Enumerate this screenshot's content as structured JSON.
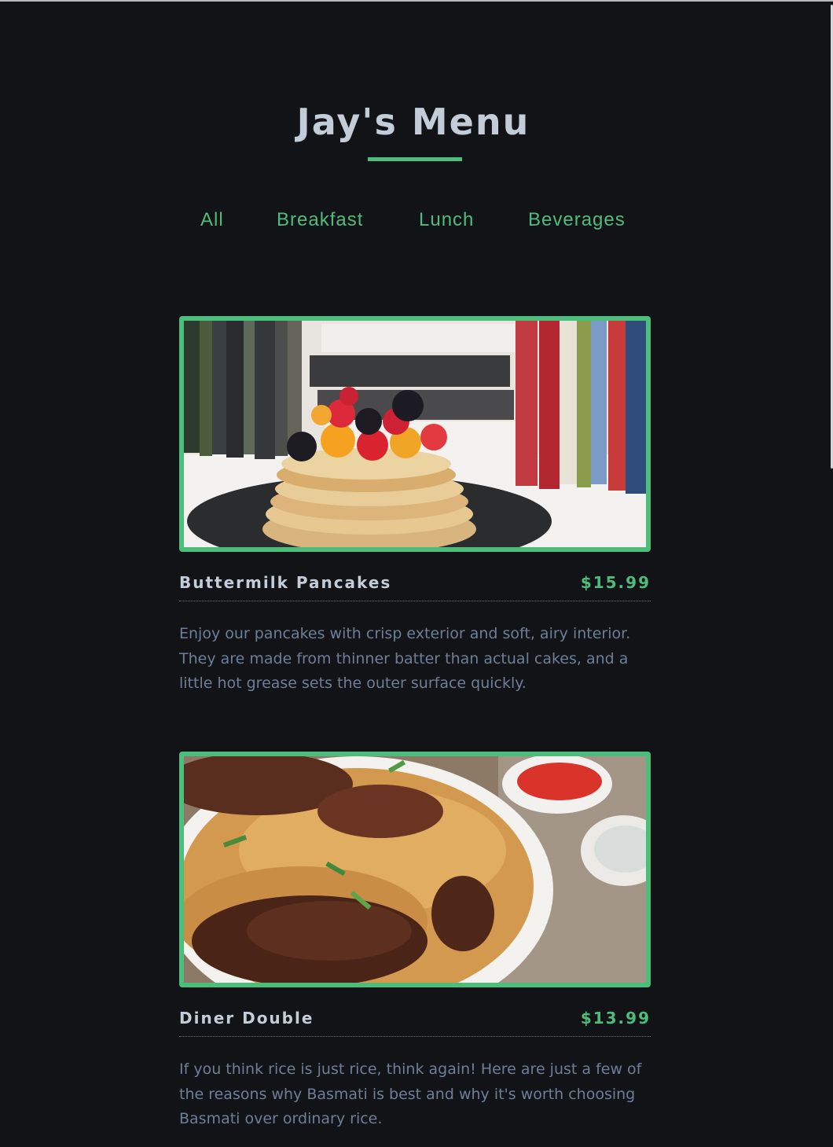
{
  "header": {
    "title": "Jay's Menu"
  },
  "nav": {
    "items": [
      "All",
      "Breakfast",
      "Lunch",
      "Beverages"
    ]
  },
  "colors": {
    "background": "#121316",
    "accent": "#4dbd7b",
    "title": "#c3cdd9",
    "description": "#6d7e99"
  },
  "menu": {
    "items": [
      {
        "name": "Buttermilk Pancakes",
        "price": "$15.99",
        "description": "Enjoy our pancakes with crisp exterior and soft, airy interior. They are made from thinner batter than actual cakes, and a little hot grease sets the outer surface quickly.",
        "image": "pancakes-photo"
      },
      {
        "name": "Diner Double",
        "price": "$13.99",
        "description": "If you think rice is just rice, think again! Here are just a few of the reasons why Basmati is best and why it's worth choosing Basmati over ordinary rice.",
        "image": "chicken-biryani-photo"
      }
    ]
  }
}
